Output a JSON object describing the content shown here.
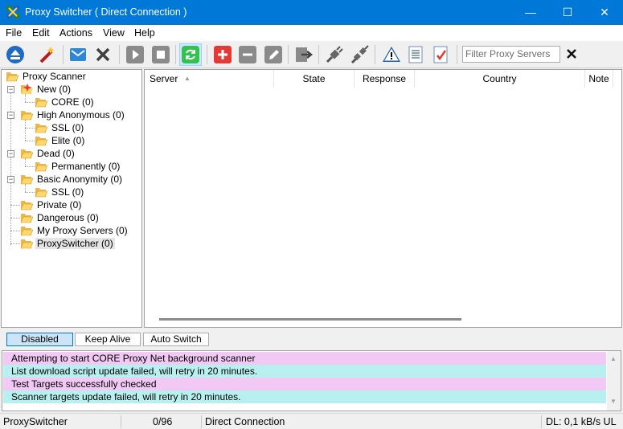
{
  "window": {
    "title": "Proxy Switcher ( Direct Connection )",
    "minimize_glyph": "—",
    "maximize_glyph": "☐",
    "close_glyph": "✕"
  },
  "menu": [
    "File",
    "Edit",
    "Actions",
    "View",
    "Help"
  ],
  "toolbar": {
    "icons": [
      "eject-icon",
      "magic-wand-icon",
      "email-icon",
      "delete-x-icon",
      "play-icon",
      "stop-icon",
      "refresh-cycle-icon",
      "add-icon",
      "remove-icon",
      "edit-pencil-icon",
      "export-arrow-icon",
      "plug-connect-icon",
      "plug-disconnect-icon",
      "warning-icon",
      "document-icon",
      "checklist-icon"
    ],
    "filter_placeholder": "Filter Proxy Servers"
  },
  "tree": {
    "root": "Proxy Scanner",
    "nodes": {
      "new": "New (0)",
      "core": "CORE (0)",
      "high_anon": "High Anonymous (0)",
      "ssl1": "SSL (0)",
      "elite": "Elite (0)",
      "dead": "Dead (0)",
      "permanently": "Permanently (0)",
      "basic_anon": "Basic Anonymity (0)",
      "ssl2": "SSL (0)",
      "private": "Private (0)",
      "dangerous": "Dangerous (0)",
      "my_proxy": "My Proxy Servers (0)",
      "proxyswitcher": "ProxySwitcher (0)"
    }
  },
  "list": {
    "columns": {
      "server": "Server",
      "state": "State",
      "response": "Response",
      "country": "Country",
      "note": "Note"
    },
    "sort_glyph": "▲"
  },
  "modes": {
    "disabled": "Disabled",
    "keep_alive": "Keep Alive",
    "auto_switch": "Auto Switch"
  },
  "log": [
    "Attempting to start CORE Proxy Net background scanner",
    "List download script update failed, will retry in 20 minutes.",
    "Test Targets successfully checked",
    "Scanner targets update failed, will retry in 20 minutes."
  ],
  "colors": {
    "titlebar": "#0078d7",
    "log_pink": "#f2c8f5",
    "log_cyan": "#b8f0ef"
  },
  "status": {
    "app": "ProxySwitcher",
    "count": "0/96",
    "connection": "Direct Connection",
    "speed": "DL: 0,1 kB/s UL"
  }
}
